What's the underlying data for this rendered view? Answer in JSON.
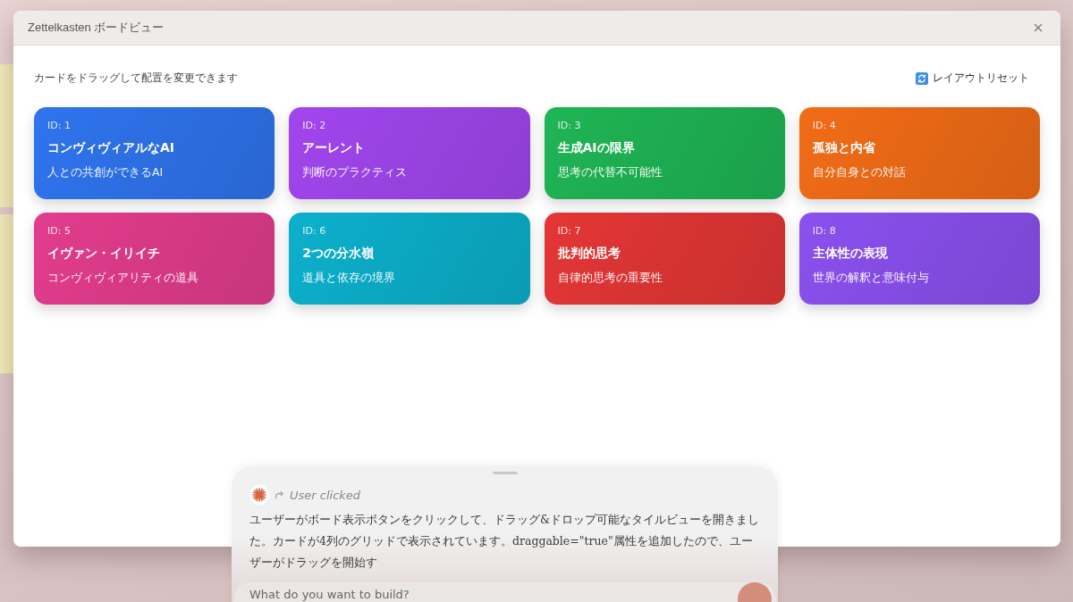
{
  "window": {
    "title": "Zettelkasten ボードビュー"
  },
  "board": {
    "hint": "カードをドラッグして配置を変更できます",
    "reset_button": "レイアウトリセット",
    "cards": [
      {
        "id": "ID: 1",
        "title": "コンヴィヴィアルなAI",
        "subtitle": "人との共創ができるAI",
        "color": "#2f74ee"
      },
      {
        "id": "ID: 2",
        "title": "アーレント",
        "subtitle": "判断のプラクティス",
        "color": "#a146ee"
      },
      {
        "id": "ID: 3",
        "title": "生成AIの限界",
        "subtitle": "思考の代替不可能性",
        "color": "#1fb555"
      },
      {
        "id": "ID: 4",
        "title": "孤独と内省",
        "subtitle": "自分自身との対話",
        "color": "#f26c17"
      },
      {
        "id": "ID: 5",
        "title": "イヴァン・イリイチ",
        "subtitle": "コンヴィヴィアリティの道具",
        "color": "#e33c8e"
      },
      {
        "id": "ID: 6",
        "title": "2つの分水嶺",
        "subtitle": "道具と依存の境界",
        "color": "#0cb0cc"
      },
      {
        "id": "ID: 7",
        "title": "批判的思考",
        "subtitle": "自律的思考の重要性",
        "color": "#e43636"
      },
      {
        "id": "ID: 8",
        "title": "主体性の表現",
        "subtitle": "世界の解釈と意味付与",
        "color": "#8b50ef"
      }
    ]
  },
  "chat": {
    "event": "User clicked",
    "message": "ユーザーがボード表示ボタンをクリックして、ドラッグ&ドロップ可能なタイルビューを開きました。カードが4列のグリッドで表示されています。draggable=\"true\"属性を追加したので、ユーザーがドラッグを開始す",
    "input": {
      "placeholder": "What do you want to build?"
    }
  }
}
